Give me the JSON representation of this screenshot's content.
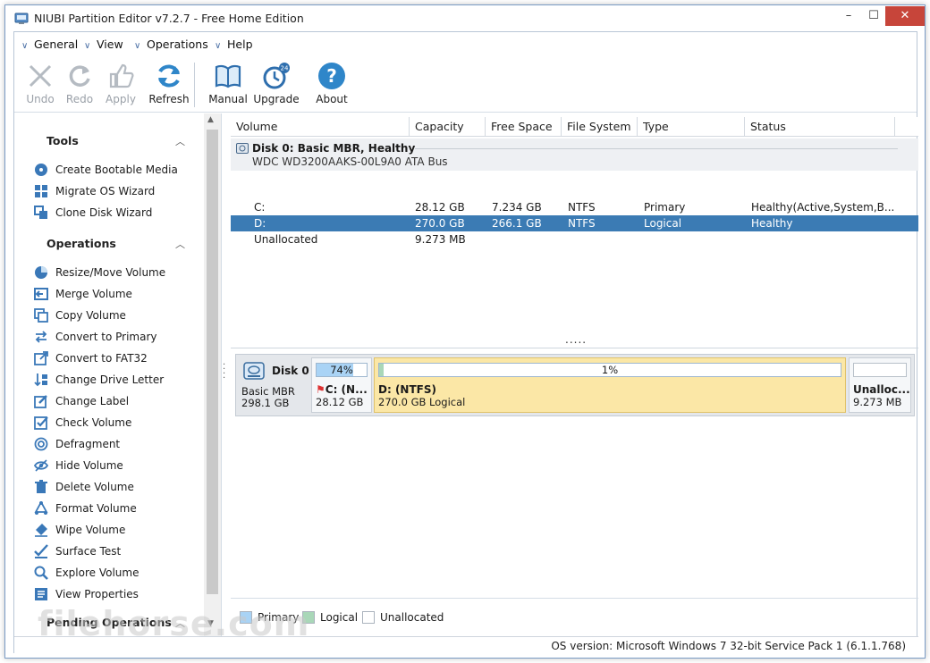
{
  "window": {
    "title": "NIUBI Partition Editor v7.2.7 - Free Home Edition",
    "min_glyph": "–",
    "max_glyph": "☐",
    "close_glyph": "✕"
  },
  "menu": [
    {
      "label": "General"
    },
    {
      "label": "View"
    },
    {
      "label": "Operations"
    },
    {
      "label": "Help"
    }
  ],
  "toolbar": {
    "undo": "Undo",
    "redo": "Redo",
    "apply": "Apply",
    "refresh": "Refresh",
    "manual": "Manual",
    "upgrade": "Upgrade",
    "about": "About"
  },
  "sidebar": {
    "tools_title": "Tools",
    "tools": [
      {
        "label": "Create Bootable Media",
        "icon": "disc-icon"
      },
      {
        "label": "Migrate OS Wizard",
        "icon": "windows-icon"
      },
      {
        "label": "Clone Disk Wizard",
        "icon": "clone-icon"
      }
    ],
    "operations_title": "Operations",
    "operations": [
      {
        "label": "Resize/Move Volume",
        "icon": "resize-icon"
      },
      {
        "label": "Merge Volume",
        "icon": "merge-icon"
      },
      {
        "label": "Copy Volume",
        "icon": "copy-icon"
      },
      {
        "label": "Convert to Primary",
        "icon": "convert-icon"
      },
      {
        "label": "Convert to FAT32",
        "icon": "convert-fat-icon"
      },
      {
        "label": "Change Drive Letter",
        "icon": "drive-letter-icon"
      },
      {
        "label": "Change Label",
        "icon": "label-icon"
      },
      {
        "label": "Check Volume",
        "icon": "check-icon"
      },
      {
        "label": "Defragment",
        "icon": "defrag-icon"
      },
      {
        "label": "Hide Volume",
        "icon": "hide-icon"
      },
      {
        "label": "Delete Volume",
        "icon": "delete-icon"
      },
      {
        "label": "Format Volume",
        "icon": "format-icon"
      },
      {
        "label": "Wipe Volume",
        "icon": "wipe-icon"
      },
      {
        "label": "Surface Test",
        "icon": "surface-test-icon"
      },
      {
        "label": "Explore Volume",
        "icon": "explore-icon"
      },
      {
        "label": "View Properties",
        "icon": "properties-icon"
      }
    ],
    "pending_title": "Pending Operations"
  },
  "table": {
    "headers": [
      "Volume",
      "Capacity",
      "Free Space",
      "File System",
      "Type",
      "Status"
    ],
    "disk": {
      "name": "Disk 0: Basic MBR, Healthy",
      "model": "WDC WD3200AAKS-00L9A0 ATA Bus"
    },
    "rows": [
      {
        "volume": "C:",
        "capacity": "28.12 GB",
        "free": "7.234 GB",
        "fs": "NTFS",
        "type": "Primary",
        "status": "Healthy(Active,System,B..."
      },
      {
        "volume": "D:",
        "capacity": "270.0 GB",
        "free": "266.1 GB",
        "fs": "NTFS",
        "type": "Logical",
        "status": "Healthy"
      },
      {
        "volume": "Unallocated",
        "capacity": "9.273 MB",
        "free": "",
        "fs": "",
        "type": "",
        "status": ""
      }
    ],
    "splitter_dots": "....."
  },
  "diskmap": {
    "disk_name": "Disk 0",
    "disk_type": "Basic MBR",
    "disk_size": "298.1 GB",
    "partitions": [
      {
        "pct_label": "74%",
        "used": 0.74,
        "name": "C: (N...",
        "size": "28.12 GB",
        "kind": "primary"
      },
      {
        "pct_label": "1%",
        "used": 0.01,
        "name": "D: (NTFS)",
        "size": "270.0 GB Logical",
        "kind": "logical"
      },
      {
        "pct_label": "",
        "used": 0,
        "name": "Unalloc...",
        "size": "9.273 MB",
        "kind": "unallocated"
      }
    ]
  },
  "legend": {
    "primary": "Primary",
    "logical": "Logical",
    "unallocated": "Unallocated"
  },
  "colors": {
    "primary": "#a9d3f5",
    "logical": "#a9d7b8",
    "unallocated": "#ffffff",
    "selected_row": "#3b7bb4",
    "logical_bg": "#fbe7a6"
  },
  "status": {
    "os": "OS version: Microsoft Windows 7  32-bit Service Pack 1 (6.1.1.768)"
  },
  "watermark": "filehorse.com"
}
